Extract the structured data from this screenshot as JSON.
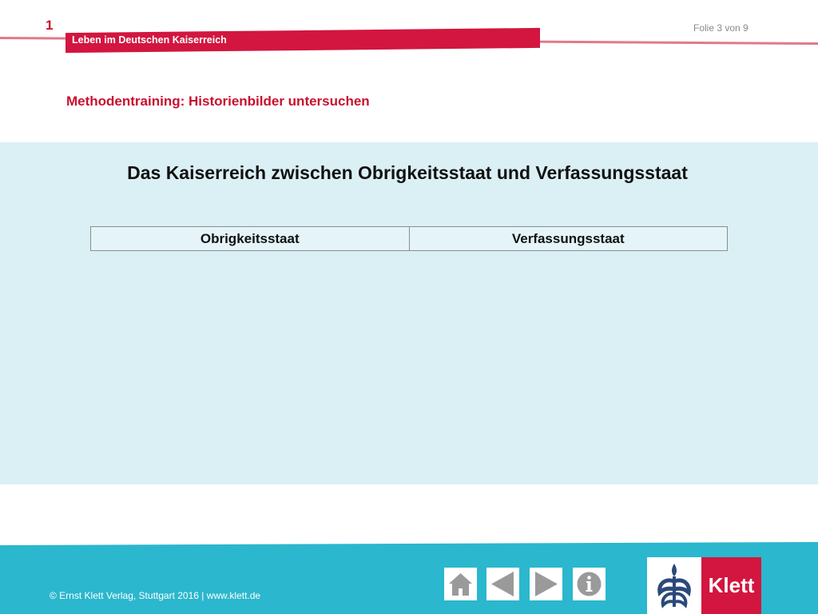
{
  "header": {
    "chapter_number": "1",
    "banner_title": "Leben im Deutschen Kaiserreich",
    "slide_counter": "Folie 3 von 9",
    "subtitle": "Methodentraining: Historienbilder untersuchen"
  },
  "main": {
    "heading": "Das Kaiserreich zwischen Obrigkeitsstaat und Verfassungsstaat",
    "table": {
      "columns": [
        "Obrigkeitsstaat",
        "Verfassungsstaat"
      ]
    }
  },
  "footer": {
    "copyright": "© Ernst Klett Verlag, Stuttgart 2016 | www.klett.de",
    "nav": [
      {
        "icon": "home-icon"
      },
      {
        "icon": "arrow-left-icon"
      },
      {
        "icon": "arrow-right-icon"
      },
      {
        "icon": "info-icon"
      }
    ],
    "logo_text": "Klett"
  },
  "colors": {
    "brand_red": "#d2163f",
    "panel_blue": "#dbf0f5",
    "footer_teal": "#2bb7cd",
    "nav_gray": "#9a9a9a"
  }
}
